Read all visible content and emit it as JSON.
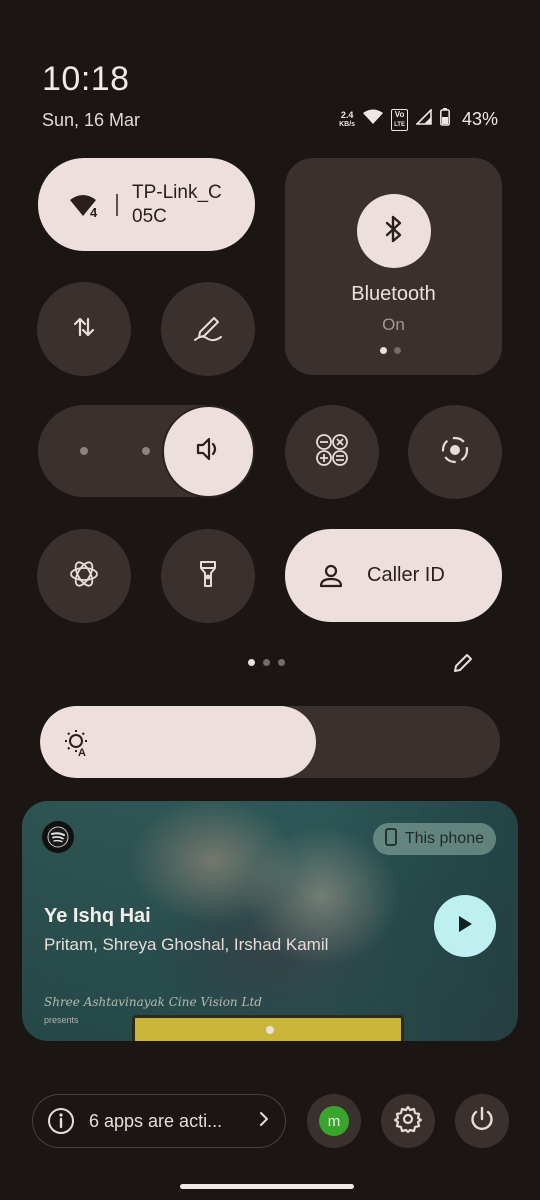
{
  "status": {
    "time": "10:18",
    "date": "Sun, 16 Mar",
    "net_speed_value": "2.4",
    "net_speed_unit": "KB/s",
    "volte_top": "Vo",
    "volte_bottom": "LTE",
    "battery": "43%"
  },
  "tiles": {
    "wifi": {
      "name": "TP-Link_C\n05C",
      "icon": "wifi-icon",
      "badge": "4"
    },
    "bluetooth": {
      "label": "Bluetooth",
      "state": "On",
      "icon": "bluetooth-icon"
    },
    "mobile_data": {
      "icon": "mobile-data-icon"
    },
    "note": {
      "icon": "pen-note-icon"
    },
    "volume": {
      "icon": "volume-icon"
    },
    "calculator": {
      "icon": "calculator-icon"
    },
    "screen_record": {
      "icon": "screen-record-icon"
    },
    "chatgpt": {
      "icon": "chatgpt-icon"
    },
    "flashlight": {
      "icon": "flashlight-icon"
    },
    "caller_id": {
      "label": "Caller ID",
      "icon": "person-icon"
    }
  },
  "brightness": {
    "level_percent": 60,
    "icon": "auto-brightness-icon"
  },
  "media": {
    "app": "spotify-icon",
    "output": "This phone",
    "title": "Ye Ishq Hai",
    "artist": "Pritam, Shreya Ghoshal, Irshad Kamil",
    "credit": "Shree Ashtavinayak Cine Vision Ltd",
    "credit_sub": "presents"
  },
  "footer": {
    "apps_active": "6 apps are acti...",
    "avatar_letter": "m"
  },
  "colors": {
    "background": "#1b1514",
    "tile_dark": "#3a312f",
    "tile_light": "#ecdfdc",
    "play_button": "#bff0f0",
    "avatar": "#3aa52c"
  }
}
